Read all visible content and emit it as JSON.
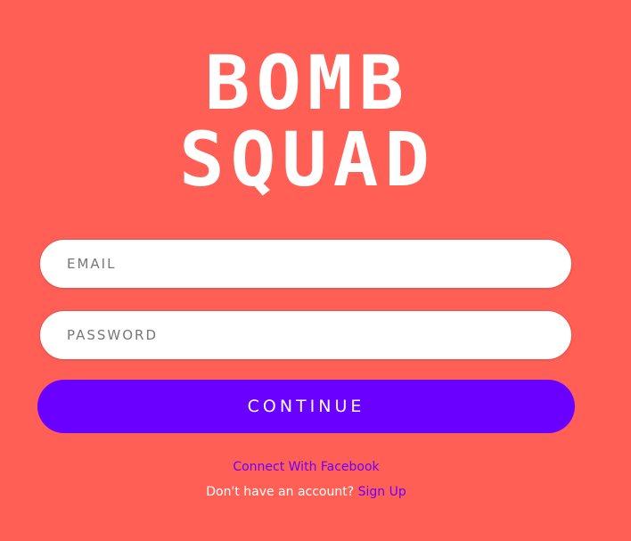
{
  "logo": {
    "line1": "BOMB",
    "line2": "SQUAD"
  },
  "form": {
    "email": {
      "placeholder": "EMAIL",
      "value": ""
    },
    "password": {
      "placeholder": "PASSWORD",
      "value": ""
    },
    "continue_label": "CONTINUE"
  },
  "links": {
    "facebook": "Connect With Facebook",
    "no_account_text": "Don't have an account?",
    "signup": "Sign Up"
  },
  "colors": {
    "background": "#FF5F55",
    "accent": "#6A00FF",
    "logo_text": "#FFFFFF"
  }
}
